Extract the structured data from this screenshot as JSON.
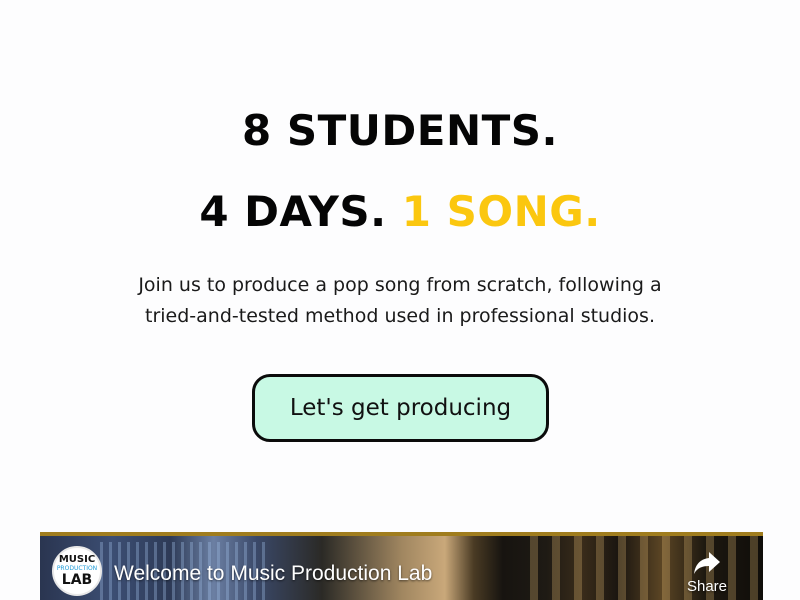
{
  "hero": {
    "line1": "8 STUDENTS.",
    "line2_main": "4 DAYS.",
    "line2_accent": "1 SONG.",
    "subtitle_line1": "Join us to produce a pop song from scratch, following a",
    "subtitle_line2": "tried-and-tested method used in professional studios.",
    "cta_label": "Let's get producing"
  },
  "video": {
    "title": "Welcome to Music Production Lab",
    "share_label": "Share",
    "share_icon": "share-arrow-icon",
    "channel_logo": {
      "top": "MUSIC",
      "middle": "PRODUCTION",
      "bottom": "LAB"
    }
  },
  "colors": {
    "accent": "#fbc70f",
    "cta_background": "#c8f9e4",
    "text": "#050505"
  }
}
